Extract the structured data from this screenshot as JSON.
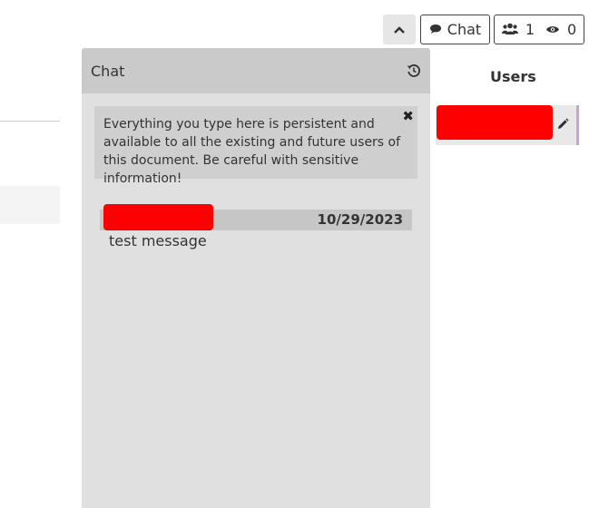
{
  "toolbar": {
    "collapse_icon": "chevron-up-icon",
    "chat_label": "Chat",
    "users_count": "1",
    "viewers_count": "0"
  },
  "chat": {
    "title": "Chat",
    "warning": "Everything you type here is persistent and available to all the existing and future users of this document. Be careful with sensitive information!",
    "close_glyph": "✖",
    "messages": [
      {
        "author": "",
        "date": "10/29/2023",
        "text": "test message"
      }
    ]
  },
  "users_panel": {
    "heading": "Users",
    "users": [
      {
        "name": ""
      }
    ]
  },
  "colors": {
    "panel_bg": "#e0e0e0",
    "header_bg": "#cacaca",
    "redaction": "#ff0000",
    "user_border": "#c8a2d8"
  }
}
